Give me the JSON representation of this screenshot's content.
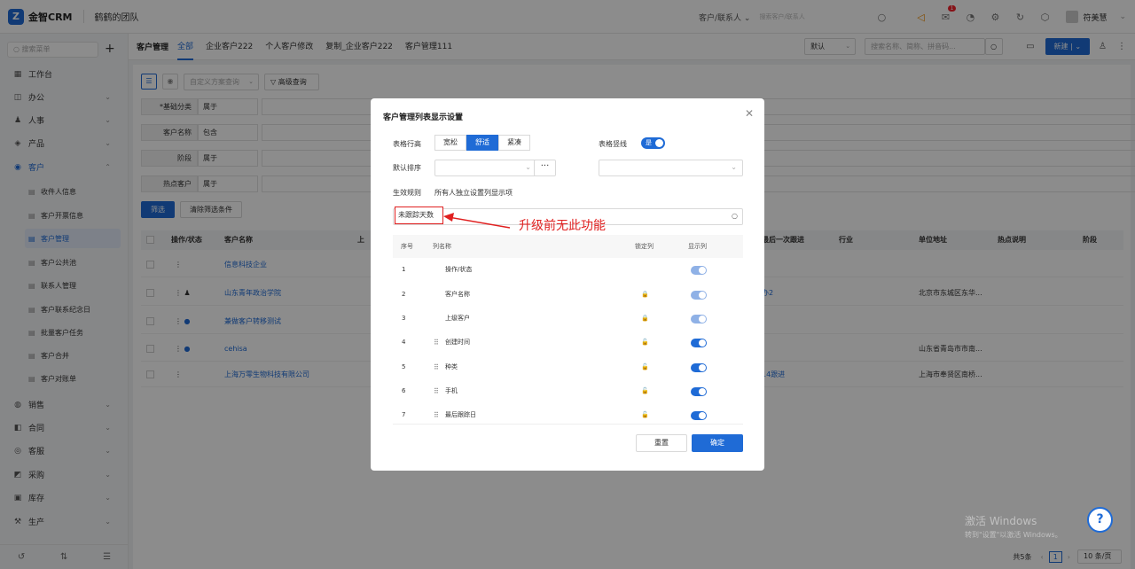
{
  "app": {
    "name": "金智CRM",
    "team": "鹤鹤的团队",
    "logo_letter": "Z"
  },
  "topbar": {
    "scope": "客户/联系人",
    "search_placeholder": "搜索客户/联系人",
    "notification_count": "1",
    "user_name": "符美慧"
  },
  "sidebar": {
    "search_placeholder": "搜索菜单",
    "items": [
      {
        "label": "工作台",
        "icon": "home-icon"
      },
      {
        "label": "办公",
        "icon": "office-icon"
      },
      {
        "label": "人事",
        "icon": "people-icon"
      },
      {
        "label": "产品",
        "icon": "product-icon"
      },
      {
        "label": "客户",
        "icon": "customer-icon"
      },
      {
        "label": "销售",
        "icon": "sales-icon"
      },
      {
        "label": "合同",
        "icon": "contract-icon"
      },
      {
        "label": "客服",
        "icon": "service-icon"
      },
      {
        "label": "采购",
        "icon": "purchase-icon"
      },
      {
        "label": "库存",
        "icon": "inventory-icon"
      },
      {
        "label": "生产",
        "icon": "production-icon"
      }
    ],
    "customer_sub": [
      "收件人信息",
      "客户开票信息",
      "客户管理",
      "客户公共池",
      "联系人管理",
      "客户联系纪念日",
      "批量客户任务",
      "客户合并",
      "客户对账单"
    ]
  },
  "tabs": {
    "title": "客户管理",
    "items": [
      "全部",
      "企业客户222",
      "个人客户修改",
      "复制_企业客户222",
      "客户管理111"
    ],
    "view_select": "默认",
    "search_placeholder": "搜索名称、简称、拼音码...",
    "new_label": "新建"
  },
  "filters": {
    "custom_query": "自定义方案查询",
    "advanced": "高级查询",
    "rows": [
      {
        "label": "*基础分类",
        "op": "属于"
      },
      {
        "label": "客户名称",
        "op": "包含"
      },
      {
        "label": "阶段",
        "op": "属于"
      },
      {
        "label": "热点客户",
        "op": "属于"
      }
    ],
    "filter_btn": "筛选",
    "clear_btn": "清除筛选条件"
  },
  "table": {
    "headers": [
      "操作/状态",
      "客户名称",
      "上",
      "最后一次跟进",
      "行业",
      "单位地址",
      "热点说明",
      "阶段"
    ],
    "rows": [
      {
        "name": "信息科技企业",
        "followup": "",
        "address": ""
      },
      {
        "name": "山东青年政治学院",
        "followup": "办2",
        "address": "北京市东城区东华..."
      },
      {
        "name": "兼做客户转移测试",
        "followup": "",
        "address": ""
      },
      {
        "name": "cehisa",
        "followup": "",
        "address": "山东省青岛市市南..."
      },
      {
        "name": "上海万零生物科技有限公司",
        "followup": "14跟进",
        "address": "上海市奉贤区南桥..."
      }
    ],
    "total": "共5条",
    "page": "1",
    "page_size": "10 条/页"
  },
  "modal": {
    "title": "客户管理列表显示设置",
    "row_height_label": "表格行高",
    "row_height_options": [
      "宽松",
      "舒适",
      "紧凑"
    ],
    "row_height_selected": "舒适",
    "vertical_lines_label": "表格竖线",
    "vertical_lines_value": "是",
    "default_sort_label": "默认排序",
    "rule_label": "生效规则",
    "rule_value": "所有人独立设置列显示项",
    "search_value": "未跟踪天数",
    "col_headers": [
      "序号",
      "列名称",
      "锁定列",
      "显示列"
    ],
    "rows": [
      {
        "no": "1",
        "name": "操作/状态",
        "lock": "none",
        "draggable": false
      },
      {
        "no": "2",
        "name": "客户名称",
        "lock": "locked",
        "draggable": false
      },
      {
        "no": "3",
        "name": "上级客户",
        "lock": "locked",
        "draggable": false
      },
      {
        "no": "4",
        "name": "创建时间",
        "lock": "unlocked",
        "draggable": true
      },
      {
        "no": "5",
        "name": "种类",
        "lock": "unlocked",
        "draggable": true
      },
      {
        "no": "6",
        "name": "手机",
        "lock": "unlocked",
        "draggable": true
      },
      {
        "no": "7",
        "name": "最后跟踪日",
        "lock": "unlocked",
        "draggable": true
      }
    ],
    "reset_label": "重置",
    "confirm_label": "确定"
  },
  "annotation": {
    "text": "升级前无此功能",
    "color": "#e02020"
  },
  "watermark": {
    "line1": "激活 Windows",
    "line2": "转到\"设置\"以激活 Windows。"
  },
  "colors": {
    "accent": "#1f6bd6",
    "annotation": "#e02020"
  }
}
